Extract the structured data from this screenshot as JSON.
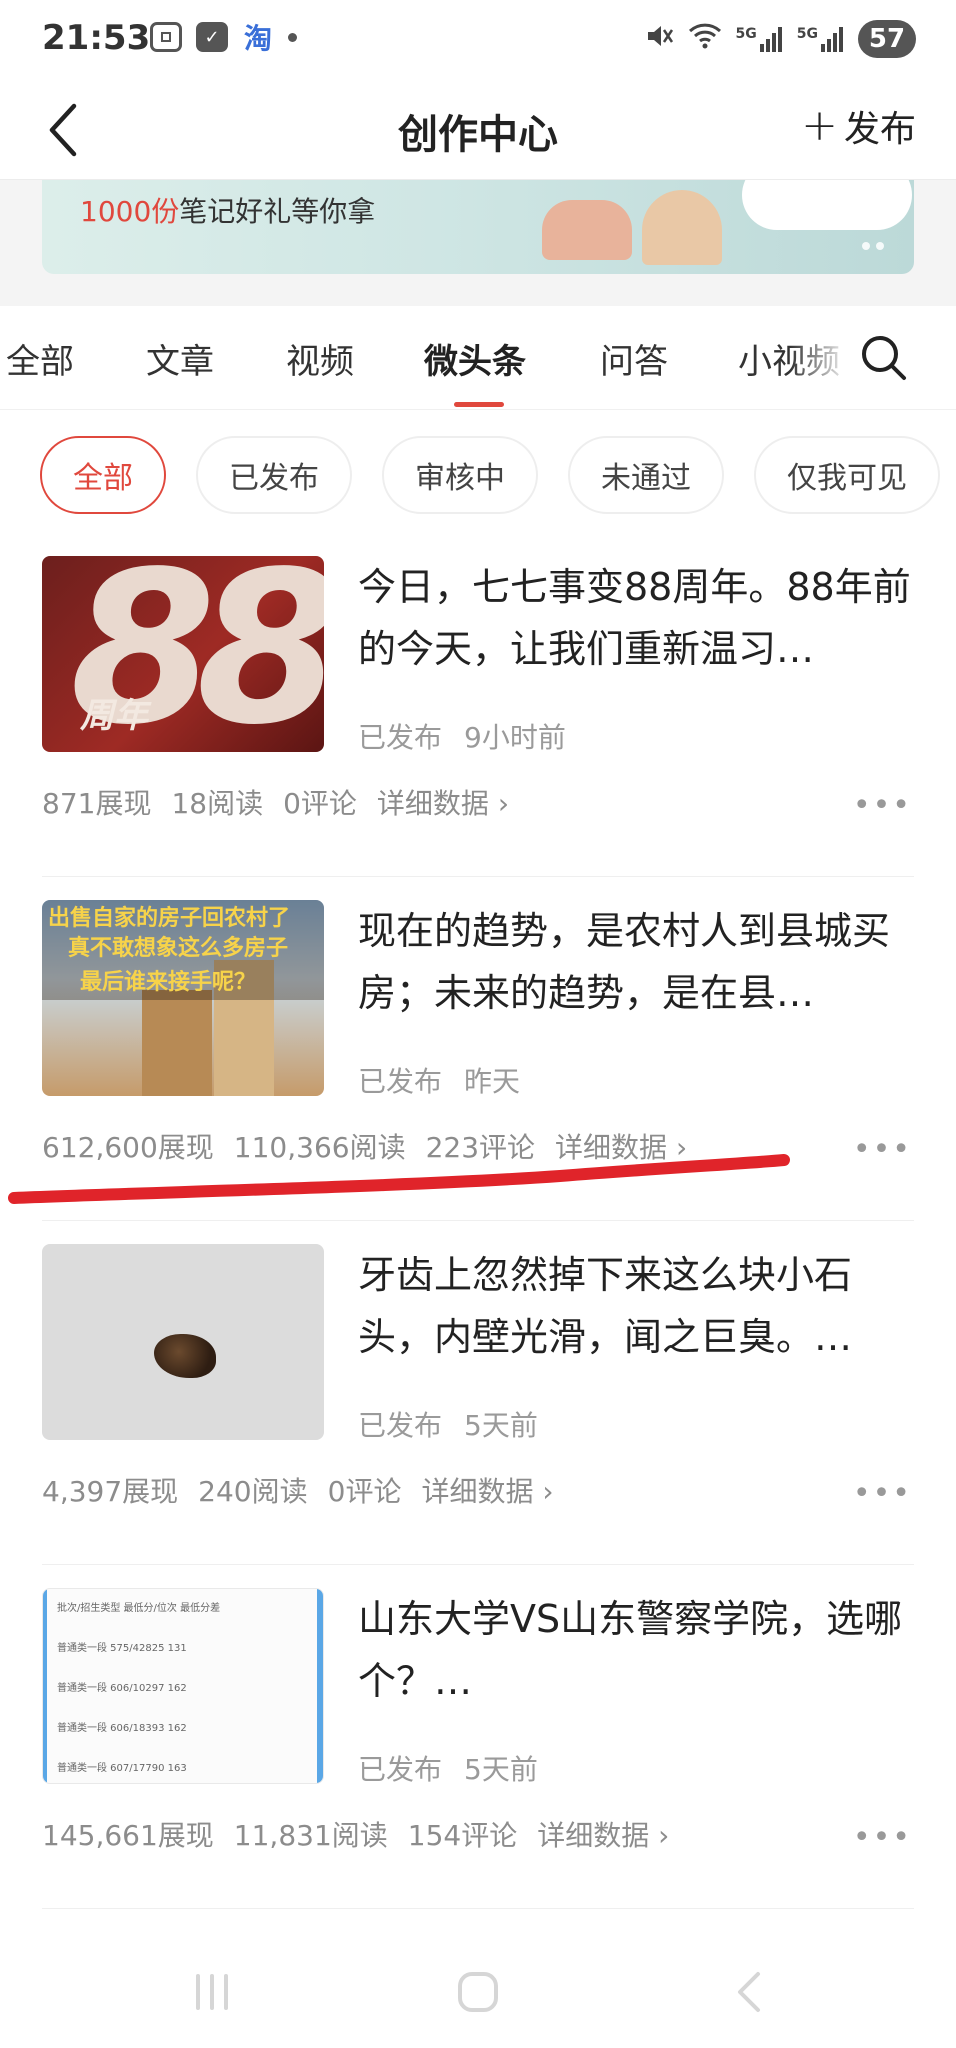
{
  "status_bar": {
    "time": "21:53",
    "left_icons": [
      "screenshot-icon",
      "app-check-icon",
      "taobao-icon"
    ],
    "taobao_glyph": "淘",
    "network_5g_1": "5G",
    "network_5g_2": "5G",
    "battery": "57"
  },
  "nav": {
    "title": "创作中心",
    "publish_label": "发布"
  },
  "banner": {
    "highlight": "1000份",
    "text": "笔记好礼等你拿"
  },
  "tabs": [
    {
      "label": "全部"
    },
    {
      "label": "文章"
    },
    {
      "label": "视频"
    },
    {
      "label": "微头条",
      "active": true
    },
    {
      "label": "问答"
    },
    {
      "label": "小视频"
    }
  ],
  "filters": [
    {
      "label": "全部",
      "active": true
    },
    {
      "label": "已发布"
    },
    {
      "label": "审核中"
    },
    {
      "label": "未通过"
    },
    {
      "label": "仅我可见"
    }
  ],
  "items": [
    {
      "title": "今日，七七事变88周年。88年前的今天，让我们重新温习…",
      "status": "已发布",
      "time": "9小时前",
      "views": "871展现",
      "reads": "18阅读",
      "comments": "0评论",
      "detail": "详细数据",
      "thumb": {
        "big_text": "88",
        "label": "周年"
      }
    },
    {
      "title": "现在的趋势，是农村人到县城买房；未来的趋势，是在县…",
      "status": "已发布",
      "time": "昨天",
      "views": "612,600展现",
      "reads": "110,366阅读",
      "comments": "223评论",
      "detail": "详细数据",
      "thumb": {
        "line1": "出售自家的房子回农村了",
        "line2": "真不敢想象这么多房子",
        "line3": "最后谁来接手呢？"
      }
    },
    {
      "title": "牙齿上忽然掉下来这么块小石头，内壁光滑，闻之巨臭。…",
      "status": "已发布",
      "time": "5天前",
      "views": "4,397展现",
      "reads": "240阅读",
      "comments": "0评论",
      "detail": "详细数据"
    },
    {
      "title": "山东大学VS山东警察学院，选哪个？…",
      "status": "已发布",
      "time": "5天前",
      "views": "145,661展现",
      "reads": "11,831阅读",
      "comments": "154评论",
      "detail": "详细数据",
      "thumb": {
        "rows": [
          "批次/招生类型   最低分/位次   最低分差",
          "普通类一段   575/42825   131",
          "普通类一段   606/10297   162",
          "普通类一段   606/18393   162",
          "普通类一段   607/17790   163"
        ]
      }
    }
  ],
  "colors": {
    "accent": "#e0483d",
    "annotation": "#e0242a"
  }
}
